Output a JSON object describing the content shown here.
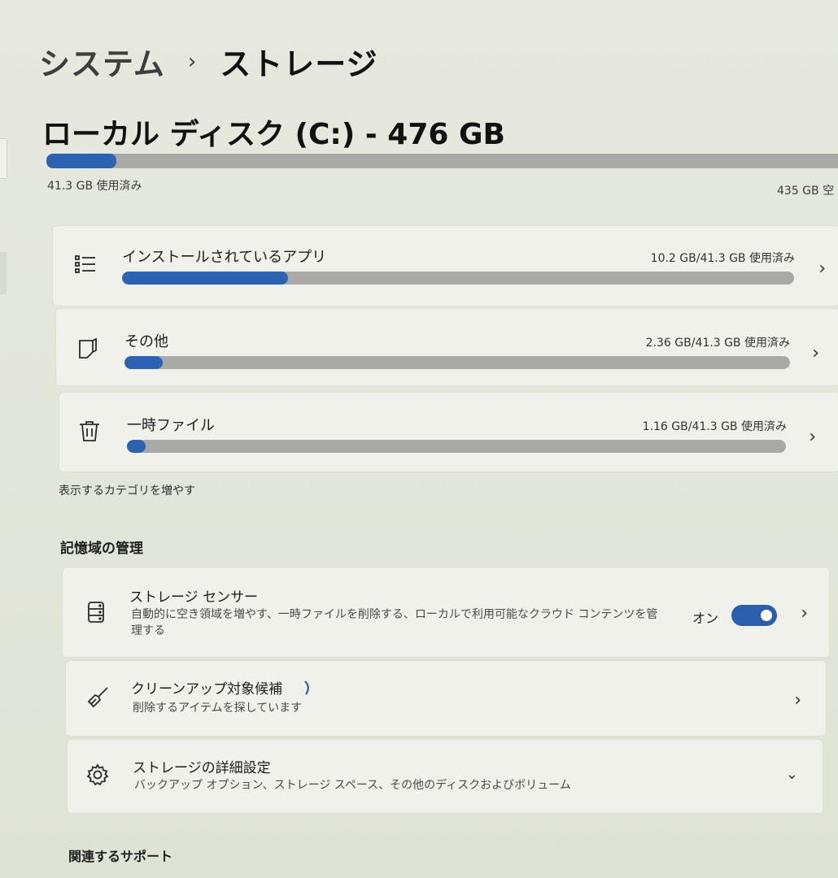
{
  "breadcrumb": {
    "parent": "システム",
    "separator": "›",
    "current": "ストレージ"
  },
  "disk": {
    "title": "ローカル ディスク (C:) - 476 GB",
    "used_label": "41.3 GB 使用済み",
    "free_label": "435 GB 空",
    "used_fraction": 0.087
  },
  "categories": [
    {
      "icon": "list-icon",
      "title": "インストールされているアプリ",
      "usage": "10.2 GB/41.3 GB 使用済み",
      "fraction": 0.247
    },
    {
      "icon": "document-icon",
      "title": "その他",
      "usage": "2.36 GB/41.3 GB 使用済み",
      "fraction": 0.057
    },
    {
      "icon": "trash-icon",
      "title": "一時ファイル",
      "usage": "1.16 GB/41.3 GB 使用済み",
      "fraction": 0.028
    }
  ],
  "show_more": "表示するカテゴリを増やす",
  "management": {
    "heading": "記憶域の管理",
    "storage_sense": {
      "title": "ストレージ センサー",
      "desc_line1": "自動的に空き領域を増やす、一時ファイルを削除する、ローカルで利用可能なクラウド コンテンツを管",
      "desc_line2": "理する",
      "toggle_label": "オン",
      "toggle_on": true
    },
    "cleanup": {
      "title": "クリーンアップ対象候補",
      "desc": "削除するアイテムを探しています"
    },
    "advanced": {
      "title": "ストレージの詳細設定",
      "desc": "バックアップ オプション、ストレージ スペース、その他のディスクおよびボリューム"
    }
  },
  "related_support": "関連するサポート",
  "colors": {
    "accent": "#2a63b1",
    "track": "#a9aaa6",
    "card": "#eff1ea"
  }
}
